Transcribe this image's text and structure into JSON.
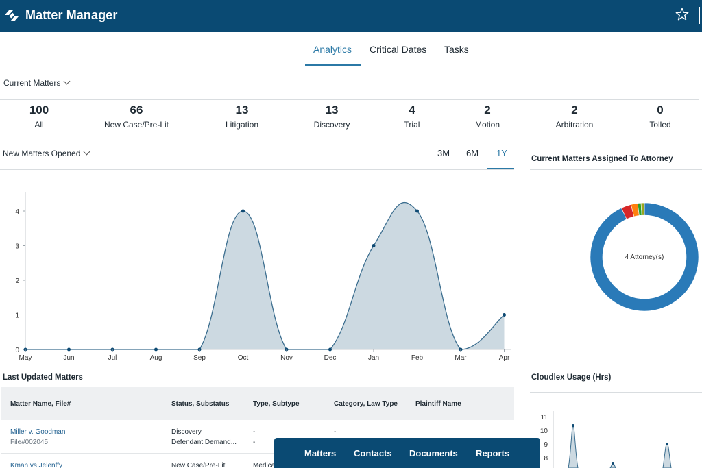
{
  "app": {
    "title": "Matter Manager"
  },
  "tabs": [
    {
      "label": "Analytics",
      "active": true
    },
    {
      "label": "Critical Dates",
      "active": false
    },
    {
      "label": "Tasks",
      "active": false
    }
  ],
  "filter": {
    "label": "Current Matters"
  },
  "stats": [
    {
      "value": "100",
      "label": "All"
    },
    {
      "value": "66",
      "label": "New Case/Pre-Lit"
    },
    {
      "value": "13",
      "label": "Litigation"
    },
    {
      "value": "13",
      "label": "Discovery"
    },
    {
      "value": "4",
      "label": "Trial"
    },
    {
      "value": "2",
      "label": "Motion"
    },
    {
      "value": "2",
      "label": "Arbitration"
    },
    {
      "value": "0",
      "label": "Tolled"
    }
  ],
  "new_matters": {
    "title": "New Matters Opened",
    "ranges": [
      {
        "label": "3M",
        "active": false
      },
      {
        "label": "6M",
        "active": false
      },
      {
        "label": "1Y",
        "active": true
      }
    ]
  },
  "chart_data": {
    "type": "area",
    "title": "",
    "xlabel": "",
    "ylabel": "",
    "categories": [
      "May",
      "Jun",
      "Jul",
      "Aug",
      "Sep",
      "Oct",
      "Nov",
      "Dec",
      "Jan",
      "Feb",
      "Mar",
      "Apr"
    ],
    "values": [
      0,
      0,
      0,
      0,
      0,
      4,
      0,
      0,
      3,
      4,
      0,
      1
    ],
    "ylim": [
      0,
      4
    ],
    "yticks": [
      "0",
      "1",
      "2",
      "3",
      "4"
    ],
    "grid": false,
    "colors": {
      "fill": "#ccd9e1",
      "line": "#3c6e8f",
      "point": "#0e4a73"
    }
  },
  "attorney_panel": {
    "title": "Current Matters Assigned To Attorney",
    "center_label": "4 Attorney(s)",
    "segments": [
      {
        "value": 93,
        "color": "#2a7ab8"
      },
      {
        "value": 3,
        "color": "#d62728"
      },
      {
        "value": 2,
        "color": "#ff7f0e"
      },
      {
        "value": 1,
        "color": "#2ca02c"
      },
      {
        "value": 1,
        "color": "#9aa51e"
      }
    ]
  },
  "last_updated": {
    "title": "Last Updated Matters",
    "columns": [
      "Matter Name, File#",
      "Status, Substatus",
      "Type, Subtype",
      "Category, Law Type",
      "Plaintiff Name"
    ],
    "rows": [
      {
        "name": "Miller v. Goodman",
        "file": "File#002045",
        "status": "Discovery",
        "substatus": "Defendant Demand...",
        "type": "-",
        "subtype": "-",
        "category": "-"
      },
      {
        "name": "Kman vs Jelenffy",
        "status": "New Case/Pre-Lit",
        "type": "Medica"
      }
    ]
  },
  "usage_panel": {
    "title": "Cloudlex Usage (Hrs)",
    "yticks": [
      "11",
      "10",
      "9",
      "8"
    ]
  },
  "bottom_nav": [
    "Matters",
    "Contacts",
    "Documents",
    "Reports"
  ]
}
